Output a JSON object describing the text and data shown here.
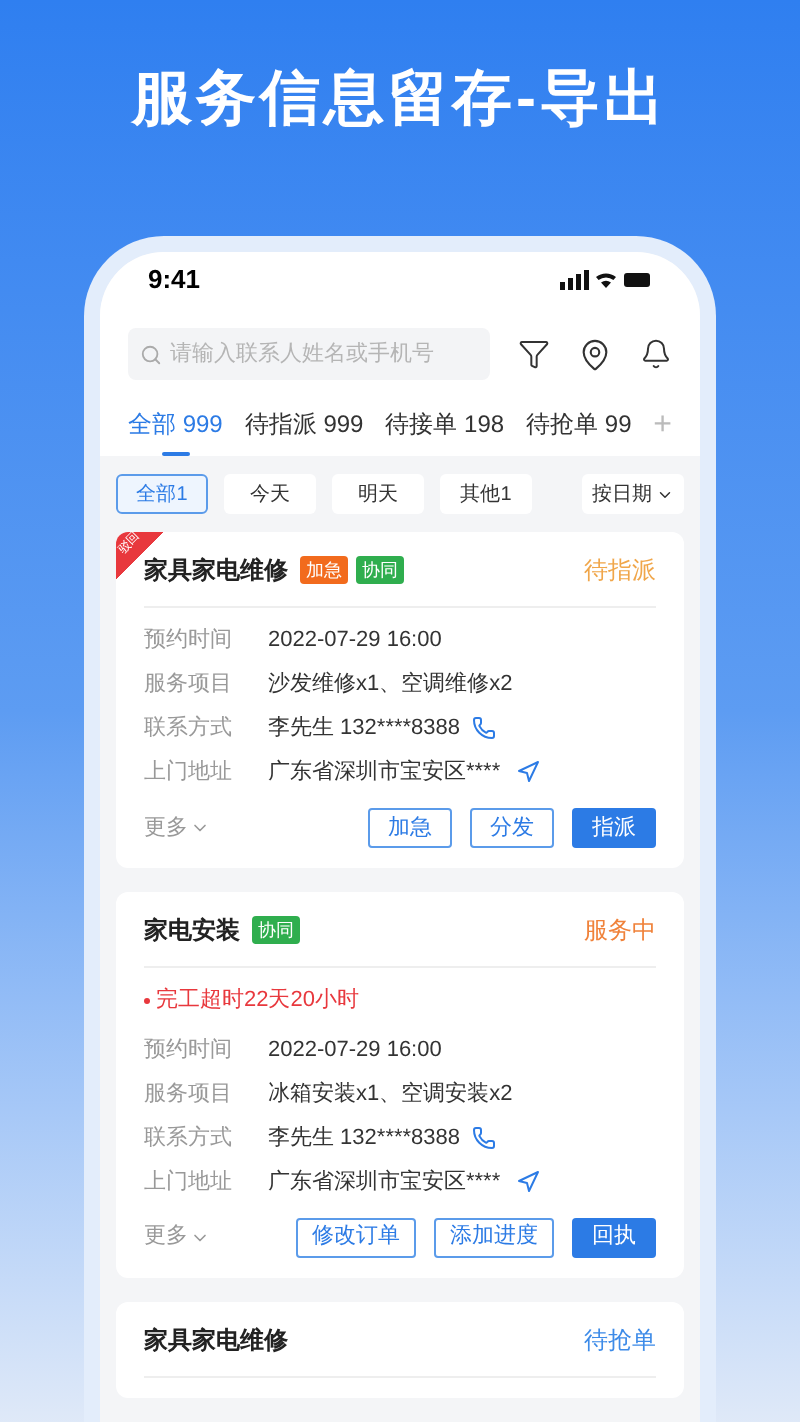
{
  "headline": "服务信息留存-导出",
  "status_bar": {
    "time": "9:41"
  },
  "search": {
    "placeholder": "请输入联系人姓名或手机号"
  },
  "tabs": [
    {
      "label": "全部 999",
      "selected": true
    },
    {
      "label": "待指派 999",
      "selected": false
    },
    {
      "label": "待接单 198",
      "selected": false
    },
    {
      "label": "待抢单 99",
      "selected": false
    }
  ],
  "add_tab": "+",
  "filters": [
    {
      "label": "全部1",
      "selected": true
    },
    {
      "label": "今天",
      "selected": false
    },
    {
      "label": "明天",
      "selected": false
    },
    {
      "label": "其他1",
      "selected": false
    }
  ],
  "sort": "按日期",
  "orders": [
    {
      "ribbon": "驳回",
      "title": "家具家电维修",
      "tags": [
        {
          "label": "加急",
          "color": "#f26b1d"
        },
        {
          "label": "协同",
          "color": "#2fae4e"
        }
      ],
      "status": {
        "label": "待指派",
        "color": "#f0a64a"
      },
      "fields": [
        {
          "label": "预约时间",
          "value": "2022-07-29 16:00",
          "kind": "text"
        },
        {
          "label": "服务项目",
          "value": "沙发维修x1、空调维修x2",
          "kind": "text"
        },
        {
          "label": "联系方式",
          "value": "李先生 132****8388",
          "kind": "phone"
        },
        {
          "label": "上门地址",
          "value": "广东省深圳市宝安区****",
          "kind": "address"
        }
      ],
      "more": "更多",
      "actions": [
        {
          "label": "加急",
          "kind": "outline"
        },
        {
          "label": "分发",
          "kind": "outline"
        },
        {
          "label": "指派",
          "kind": "primary"
        }
      ]
    },
    {
      "title": "家电安装",
      "tags": [
        {
          "label": "协同",
          "color": "#2fae4e"
        }
      ],
      "status": {
        "label": "服务中",
        "color": "#f0823a"
      },
      "alert": "完工超时22天20小时",
      "fields": [
        {
          "label": "预约时间",
          "value": "2022-07-29 16:00",
          "kind": "text"
        },
        {
          "label": "服务项目",
          "value": "冰箱安装x1、空调安装x2",
          "kind": "text"
        },
        {
          "label": "联系方式",
          "value": "李先生 132****8388",
          "kind": "phone"
        },
        {
          "label": "上门地址",
          "value": "广东省深圳市宝安区****",
          "kind": "address"
        }
      ],
      "more": "更多",
      "actions": [
        {
          "label": "修改订单",
          "kind": "outline"
        },
        {
          "label": "添加进度",
          "kind": "outline"
        },
        {
          "label": "回执",
          "kind": "primary"
        }
      ]
    },
    {
      "title": "家具家电维修",
      "status": {
        "label": "待抢单",
        "color": "#3d8be8"
      }
    }
  ]
}
